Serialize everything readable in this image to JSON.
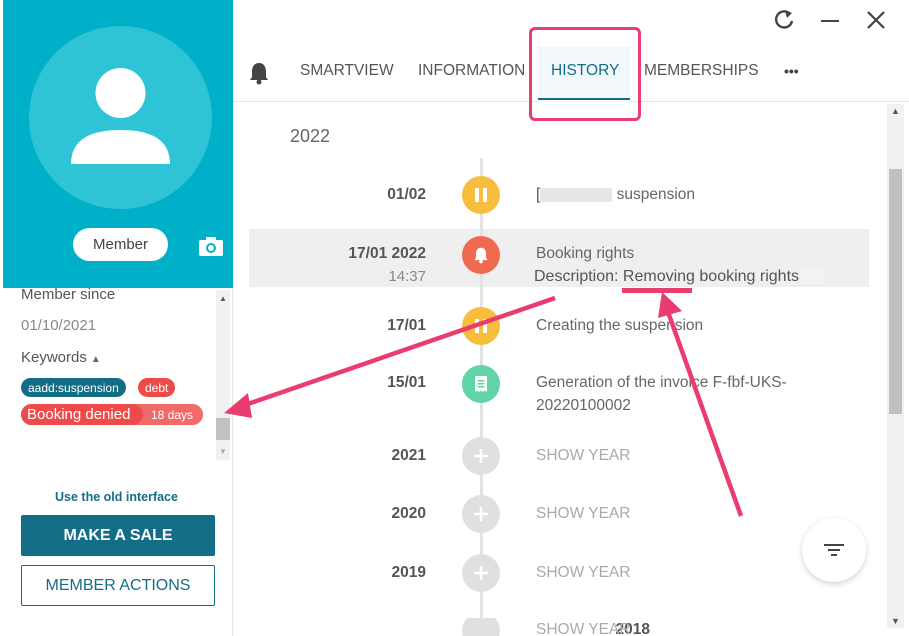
{
  "profile": {
    "member_label": "Member",
    "member_since_label": "Member since",
    "member_since_value": "01/10/2021",
    "keywords_label": "Keywords",
    "tags": [
      {
        "label": "aadd:suspension",
        "color": "#146d87"
      },
      {
        "label": "debt",
        "color": "#ef4a4a"
      }
    ],
    "booking_denied_label": "Booking denied",
    "booking_denied_days": "18 days"
  },
  "left_actions": {
    "old_interface": "Use the old interface",
    "make_sale": "MAKE A SALE",
    "member_actions": "MEMBER ACTIONS"
  },
  "tabs": [
    {
      "label": "SMARTVIEW"
    },
    {
      "label": "INFORMATION"
    },
    {
      "label": "HISTORY",
      "active": true
    },
    {
      "label": "MEMBERSHIPS"
    }
  ],
  "more_label": "•••",
  "timeline": {
    "current_year": "2022",
    "events": [
      {
        "date": "01/02",
        "icon": "pause-icon",
        "title_suffix": "suspension"
      },
      {
        "date": "17/01 2022",
        "time": "14:37",
        "icon": "bell-icon",
        "title": "Booking rights",
        "description": "Description: Removing booking  rights"
      },
      {
        "date": "17/01",
        "icon": "pause-icon",
        "title": "Creating the suspension"
      },
      {
        "date": "15/01",
        "icon": "invoice-icon",
        "title": "Generation of the invoice F-fbf-UKS-",
        "title_line2": "20220100002"
      }
    ],
    "years": [
      {
        "year": "2021",
        "action": "SHOW YEAR"
      },
      {
        "year": "2020",
        "action": "SHOW YEAR"
      },
      {
        "year": "2019",
        "action": "SHOW YEAR"
      },
      {
        "year": "2018",
        "action": "SHOW YEAR"
      }
    ]
  },
  "colors": {
    "brand": "#00afc8",
    "dark_teal": "#146d87",
    "annotation": "#ea3d6f"
  }
}
